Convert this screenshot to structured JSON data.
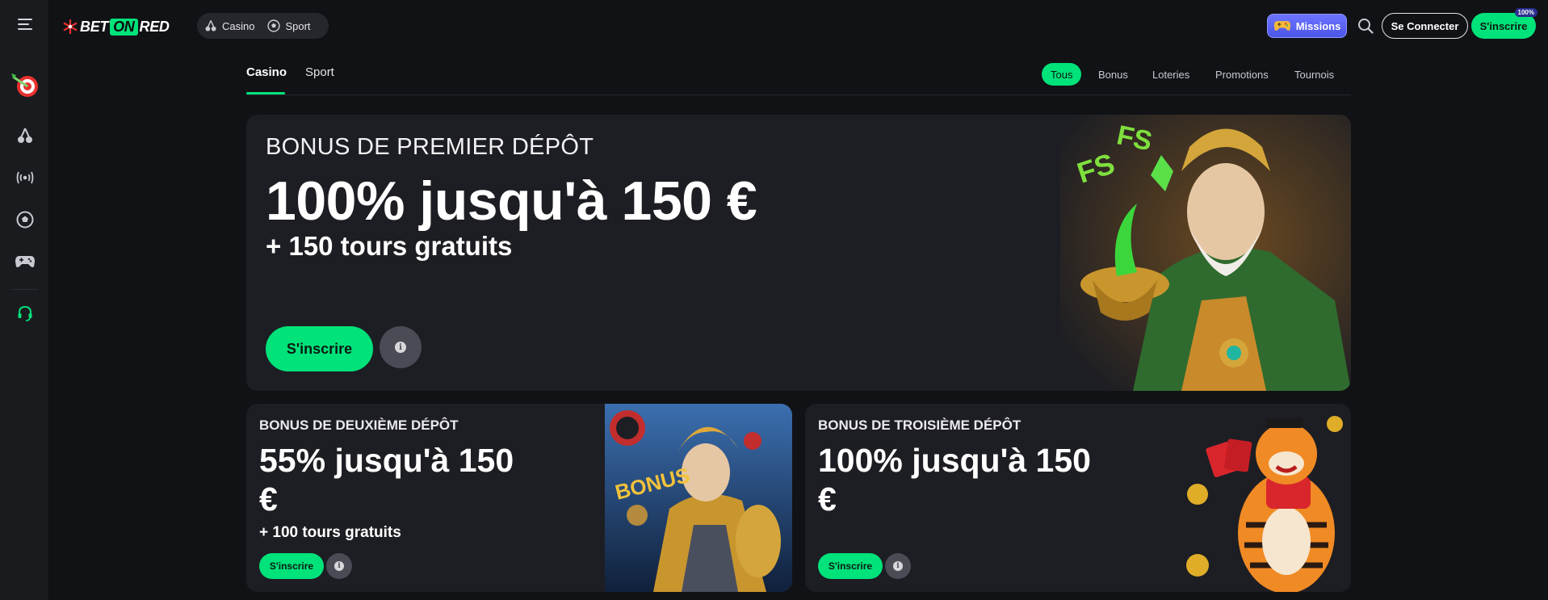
{
  "brand": {
    "logo_part1": "BET",
    "logo_part2": "ON",
    "logo_part3": "RED",
    "accent": "#00e27a"
  },
  "header": {
    "verticals": [
      {
        "label": "Casino",
        "icon": "cherries-icon"
      },
      {
        "label": "Sport",
        "icon": "soccer-ball-icon"
      }
    ],
    "missions_label": "Missions",
    "login_label": "Se Connecter",
    "signup_label": "S'inscrire",
    "signup_badge": "100%"
  },
  "sidebar": {
    "items": [
      {
        "icon": "menu-icon"
      },
      {
        "icon": "promo-target-icon"
      },
      {
        "icon": "cherries-icon"
      },
      {
        "icon": "live-broadcast-icon"
      },
      {
        "icon": "soccer-ball-icon"
      },
      {
        "icon": "gamepad-icon"
      },
      {
        "icon": "support-headset-icon"
      }
    ]
  },
  "tabs": {
    "main": [
      "Casino",
      "Sport"
    ],
    "active_main": "Casino",
    "filters": [
      "Tous",
      "Bonus",
      "Loteries",
      "Promotions",
      "Tournois"
    ],
    "active_filter": "Tous"
  },
  "promos": {
    "hero": {
      "subtitle": "BONUS DE PREMIER DÉPÔT",
      "title": "100% jusqu'à 150 €",
      "extra": "+ 150 tours gratuits",
      "cta": "S'inscrire",
      "art_text": "FS"
    },
    "second": {
      "subtitle": "BONUS DE DEUXIÈME DÉPÔT",
      "title": "55% jusqu'à 150 €",
      "extra": "+ 100 tours gratuits",
      "cta": "S'inscrire",
      "art_text": "BONUS"
    },
    "third": {
      "subtitle": "BONUS DE TROISIÈME DÉPÔT",
      "title": "100% jusqu'à 150 €",
      "cta": "S'inscrire"
    }
  }
}
